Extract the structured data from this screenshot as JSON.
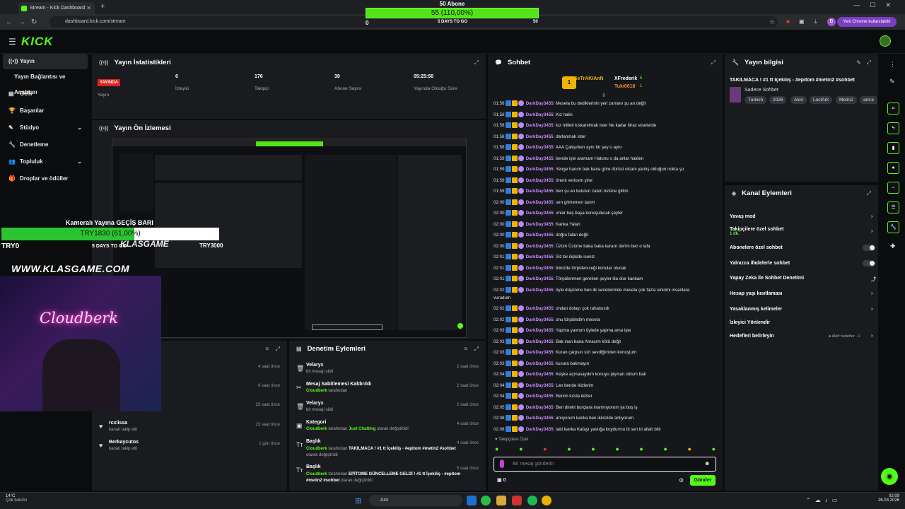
{
  "browser": {
    "tab_title": "Stream - Kick Dashboard",
    "url": "dashboard.kick.com/stream",
    "chrome_button": "Yeni Chrome kullanılabilir",
    "profile_letter": "B"
  },
  "top_goal": {
    "title": "50 Abone",
    "bar_text": "55 (110,00%)",
    "progress": 1.0,
    "min": "0",
    "days": "5 DAYS TO GO",
    "max": "50"
  },
  "brand": {
    "logo": "KICK",
    "accent": "#53fc18"
  },
  "sidebar": {
    "items": [
      {
        "label": "Yayın",
        "icon": "broadcast-icon",
        "active": true
      },
      {
        "label": "Yayın Bağlantısı ve Anahtarı"
      },
      {
        "label": "Gelir",
        "icon": "money-icon"
      },
      {
        "label": "Başarılar",
        "icon": "trophy-icon"
      },
      {
        "label": "Stüdyo",
        "icon": "brush-icon",
        "expandable": true
      },
      {
        "label": "Denetleme",
        "icon": "wrench-icon"
      },
      {
        "label": "Topluluk",
        "icon": "people-icon",
        "expandable": true
      },
      {
        "label": "Droplar ve ödüller",
        "icon": "gift-icon"
      }
    ]
  },
  "stats": {
    "title": "Yayın İstatistikleri",
    "live_badge": "YAYINDA",
    "items": [
      {
        "value": "6",
        "label": "İzleyici"
      },
      {
        "value": "176",
        "label": "Takipçi"
      },
      {
        "value": "39",
        "label": "Abone Sayısı"
      },
      {
        "value": "05:25:56",
        "label": "Yayında Olduğu Süre"
      }
    ],
    "status_label": "Yayın"
  },
  "preview": {
    "title": "Yayın Ön İzlemesi"
  },
  "overlay": {
    "goal_title": "Kameralı Yayına GEÇİŞ BARI",
    "goal_text": "TRY1830 (61,00%)",
    "goal_progress": 0.61,
    "min": "TRY0",
    "days": "5 DAYS TO GO",
    "max": "TRY3000",
    "site": "WWW.KLASGAME.COM",
    "klas": "KLASGAME",
    "neon": "Cloudberk"
  },
  "activity": {
    "rows": [
      {
        "name": "",
        "sub": "",
        "time": "4 saat önce"
      },
      {
        "name": "",
        "sub": "",
        "time": "6 saat önce"
      },
      {
        "name": "",
        "sub": "",
        "time": "23 saat önce"
      },
      {
        "name": "",
        "sub": "",
        "time": ""
      },
      {
        "name": "rcxlissa",
        "sub": "kanalı takip etti",
        "time": "23 saat önce"
      },
      {
        "name": "Berkaycutos",
        "sub": "kanalı takip etti",
        "time": "1 gün önce"
      }
    ]
  },
  "moderation": {
    "title": "Denetim Eylemleri",
    "rows": [
      {
        "name": "Velaryx",
        "sub": "bir mesajı sildi",
        "time": "2 saat önce",
        "icon": "trash-icon"
      },
      {
        "name": "Mesaj Sabitlemesi Kaldırıldı",
        "sub_user": "Cloudberk",
        "sub": "tarafından",
        "time": "2 saat önce",
        "icon": "pin-icon"
      },
      {
        "name": "Velaryx",
        "sub": "bir mesajı sildi",
        "time": "2 saat önce",
        "icon": "trash-icon"
      },
      {
        "name": "Kategori",
        "sub_user": "Cloudberk",
        "sub": "tarafından",
        "sub_hl": "Just Chatting",
        "sub_end": "olarak değiştirildi",
        "time": "4 saat önce",
        "icon": "category-icon"
      },
      {
        "name": "Başlık",
        "sub_user": "Cloudberk",
        "sub": "tarafından",
        "sub_hl": "TAKILMACA ! #1 tt İçekiliş - #epitom #metin2 #sohbet",
        "sub_end": "olarak değiştirildi",
        "time": "4 saat önce",
        "icon": "title-icon"
      },
      {
        "name": "Başlık",
        "sub_user": "Cloudberk",
        "sub": "tarafından",
        "sub_hl": "EPİTOME GÜNCELLEME GELDİ ! #1 tt İçekiliş - #epitom #metin2 #sohbet",
        "sub_end": "olarak değiştirildi",
        "time": "5 saat önce",
        "icon": "title-icon"
      }
    ]
  },
  "chat": {
    "title": "Sohbet",
    "top_gifters": [
      {
        "name": "SeTrAKIAnN",
        "count": "6"
      },
      {
        "name": "XFrederik",
        "count": "5"
      },
      {
        "name": "Tuki0618",
        "count": "1"
      }
    ],
    "messages": [
      {
        "time": "01:58",
        "user": "DarkDay3455",
        "text": "Mesela bu dediklerinin yeri zamanı şu an değil"
      },
      {
        "time": "01:58",
        "user": "DarkDay3455",
        "text": "Kız haklı"
      },
      {
        "time": "01:58",
        "user": "DarkDay3455",
        "text": "kız milleti kıskanılmak ister Ne kadar itiraz etselerde"
      },
      {
        "time": "01:58",
        "user": "DarkDay3455",
        "text": "darlanmak ister"
      },
      {
        "time": "01:58",
        "user": "DarkDay3455",
        "text": "AAA Çalışırken aynı bir şey o aynı"
      },
      {
        "time": "01:59",
        "user": "DarkDay3455",
        "text": "bende işte aramam Hatunu o da anlar halden"
      },
      {
        "time": "01:59",
        "user": "DarkDay3455",
        "text": "Yenge hanım bak bana göre dürüst olcam yanlış olduğun nokta şu"
      },
      {
        "time": "01:59",
        "user": "DarkDay3455",
        "text": "örenk vericem yine"
      },
      {
        "time": "01:59",
        "user": "DarkDay3455",
        "text": "ben şu an bulutun zaten üstüne giltim"
      },
      {
        "time": "02:00",
        "user": "DarkDay3455",
        "text": "sen gitmemen lazım"
      },
      {
        "time": "02:00",
        "user": "DarkDay3455",
        "text": "onlar baş başa konuşulucak şeyler"
      },
      {
        "time": "02:00",
        "user": "DarkDay3455",
        "text": "Kanka Yalan"
      },
      {
        "time": "02:00",
        "user": "DarkDay3455",
        "text": "doğru falan değil"
      },
      {
        "time": "02:00",
        "user": "DarkDay3455",
        "text": "Üzüm Üzüme baka baka kararır derim ben o lafa"
      },
      {
        "time": "02:01",
        "user": "DarkDay3455",
        "text": "Siz bir ilişkide iseniz"
      },
      {
        "time": "02:01",
        "user": "DarkDay3455",
        "text": "ikinizde törpülenıceği konular olucak"
      },
      {
        "time": "02:01",
        "user": "DarkDay3455",
        "text": "Törpülenmen gereken şeyler illa olur kankam"
      },
      {
        "time": "02:02",
        "user": "DarkDay3455",
        "text": "öyle düşünme ben ilk senelerimde mesela çok fazla sinirimi insanlara",
        "cont": "vurudum"
      },
      {
        "time": "02:02",
        "user": "DarkDay3455",
        "text": "ondan dolayı çok rahatsızdı"
      },
      {
        "time": "02:02",
        "user": "DarkDay3455",
        "text": "onu törpüledim mesela"
      },
      {
        "time": "02:03",
        "user": "DarkDay3455",
        "text": "Yapma yavrum öylede yapma ama işte"
      },
      {
        "time": "02:03",
        "user": "DarkDay3455",
        "text": "Bak inan bana Amacım kötü değil"
      },
      {
        "time": "02:03",
        "user": "DarkDay3455",
        "text": "Kuran çarpsın sizi sevdiğimden konuştum"
      },
      {
        "time": "02:03",
        "user": "DarkDay3455",
        "text": "kusura bakmayın"
      },
      {
        "time": "02:04",
        "user": "DarkDay3455",
        "text": "Keşke açmasaydım konuyu pişman oldum bak"
      },
      {
        "time": "02:04",
        "user": "DarkDay3455",
        "text": "Lan bende ikizlerim"
      },
      {
        "time": "02:04",
        "user": "DarkDay3455",
        "text": "Benim kızda ikizler"
      },
      {
        "time": "02:05",
        "user": "DarkDay3455",
        "text": "Ben direkt burçlara inanmıyorum ya boş iş"
      },
      {
        "time": "02:08",
        "user": "DarkDay3455",
        "text": "anlıyorum kanka ben ikinizide anlıyorum"
      },
      {
        "time": "02:08",
        "user": "DarkDay3455",
        "text": "tabi kanka Kafayı yastığa koydurmu bi sen bi allah bilir"
      }
    ],
    "mode_label": "Takipçilere Özel",
    "input_placeholder": "Bir mesaj gönderin",
    "points": "0",
    "send_label": "Gönder"
  },
  "stream_info": {
    "title": "Yayın bilgisi",
    "stream_title": "TAKILMACA ! #1 tt İçekiliş - #epitom #metin2 #sohbet",
    "category": "Sadece Sohbet",
    "tags": [
      "Turkish",
      "2026",
      "Alon",
      "LostArk",
      "Metin2",
      "arcra"
    ]
  },
  "channel_actions": {
    "title": "Kanal Eylemleri",
    "items": [
      {
        "label": "Yavaş mod",
        "kind": "arrow"
      },
      {
        "label": "Takipçilere özel sohbet",
        "sub": "1 dk.",
        "kind": "arrow"
      },
      {
        "label": "Abonelere özel sohbet",
        "kind": "toggle"
      },
      {
        "label": "Yalnızca ifadelerle sohbet",
        "kind": "toggle"
      },
      {
        "label": "Yapay Zeka ile Sohbet Denetimi",
        "kind": "external"
      },
      {
        "label": "Hesap yaşı kısıtlaması",
        "kind": "arrow"
      },
      {
        "label": "Yasaklanmış kelimeler",
        "kind": "arrow"
      },
      {
        "label": "İzleyici Yönlendir",
        "kind": "none"
      },
      {
        "label": "Hedefleri belirleyin",
        "kind": "arrow",
        "status": "Aktif hedefler - 1"
      }
    ]
  },
  "taskbar": {
    "weather_temp": "14°C",
    "weather_desc": "Çok bulutlu",
    "search_placeholder": "Ara",
    "time": "02:09",
    "date": "26.03.2026"
  }
}
